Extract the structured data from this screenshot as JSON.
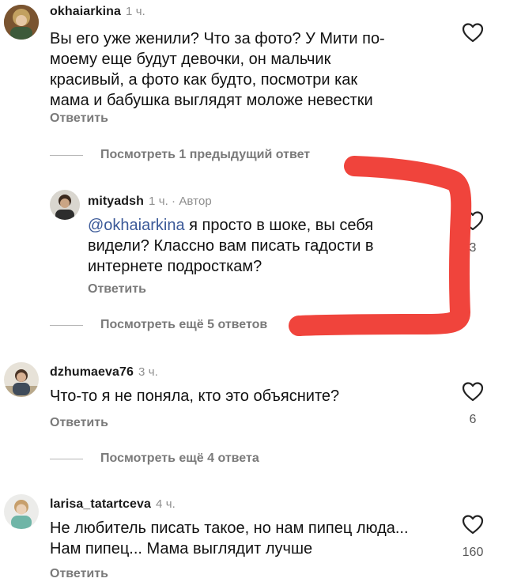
{
  "comments": [
    {
      "username": "okhaiarkina",
      "time": "1 ч.",
      "text": "Вы его уже женили? Что за фото? У Мити по-\nмоему еще будут девочки, он мальчик\nкрасивый,  а фото как будто,  посмотри как\nмама и бабушка выглядят моложе невестки",
      "reply_label": "Ответить",
      "likes": ""
    },
    {
      "username": "mityadsh",
      "time": "1 ч.",
      "author_badge": "· Автор",
      "mention": "@okhaiarkina",
      "text": " я просто в шоке, вы себя\nвидели? Классно вам писать гадости в\nинтернете подросткам?",
      "reply_label": "Ответить",
      "likes": "3"
    },
    {
      "username": "dzhumaeva76",
      "time": "3 ч.",
      "text": "Что-то я не поняла, кто это объясните?",
      "reply_label": "Ответить",
      "likes": "6"
    },
    {
      "username": "larisa_tatartceva",
      "time": "4 ч.",
      "text": "Не любитель писать такое, но нам пипец люда...\nНам пипец... Мама выглядит лучше",
      "reply_label": "Ответить",
      "likes": "160"
    }
  ],
  "view_more": [
    "Посмотреть 1 предыдущий ответ",
    "Посмотреть ещё 5 ответов",
    "Посмотреть ещё 4 ответа"
  ],
  "colors": {
    "annotation_red": "#f0443c",
    "secondary_text": "#7a7a7a",
    "mention_blue": "#3b5998"
  },
  "icons": [
    "heart-icon"
  ]
}
